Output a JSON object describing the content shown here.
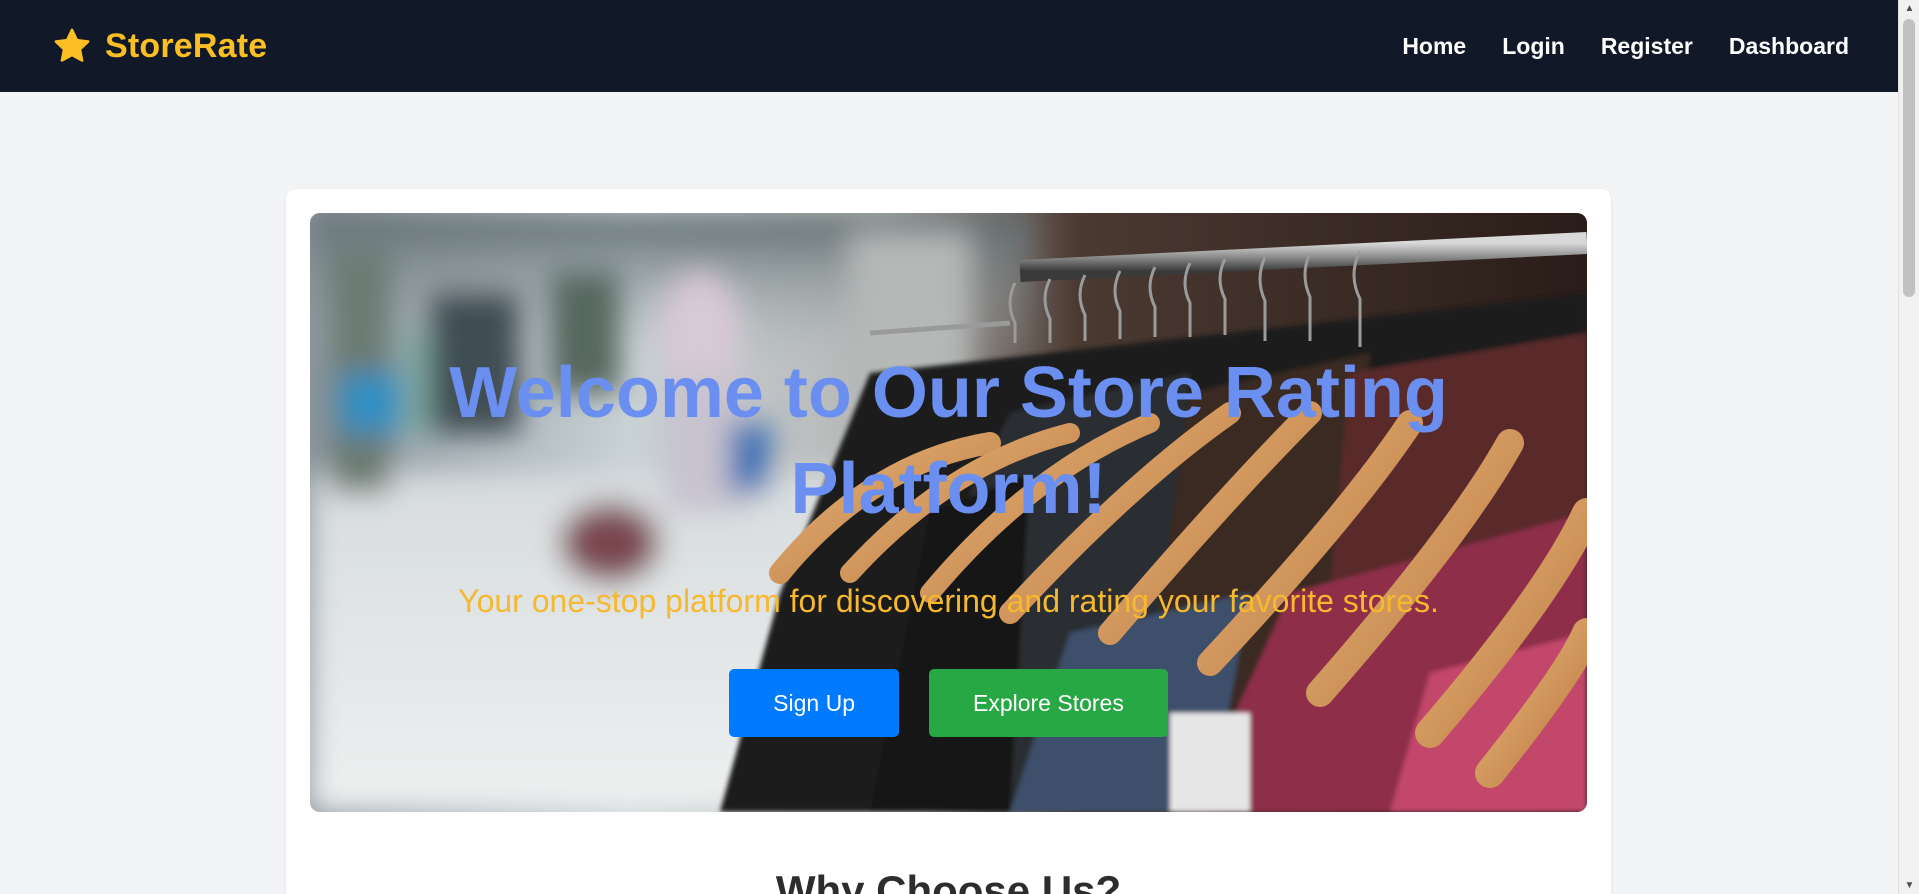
{
  "navbar": {
    "brand_icon": "star-icon",
    "brand_name": "StoreRate",
    "brand_color": "#fbbf24",
    "background": "#111827",
    "links": [
      {
        "label": "Home"
      },
      {
        "label": "Login"
      },
      {
        "label": "Register"
      },
      {
        "label": "Dashboard"
      }
    ]
  },
  "hero": {
    "image": "clothing-rack-photo",
    "title": "Welcome to Our Store Rating Platform!",
    "title_color": "#6b8ff0",
    "subtitle": "Your one-stop platform for discovering and rating your favorite stores.",
    "subtitle_color": "#f6b82f",
    "buttons": [
      {
        "label": "Sign Up",
        "color": "#007bff"
      },
      {
        "label": "Explore Stores",
        "color": "#28a745"
      }
    ]
  },
  "section": {
    "title": "Why Choose Us?"
  },
  "colors": {
    "page_background": "#f3f4f6",
    "card_background": "#ffffff"
  }
}
